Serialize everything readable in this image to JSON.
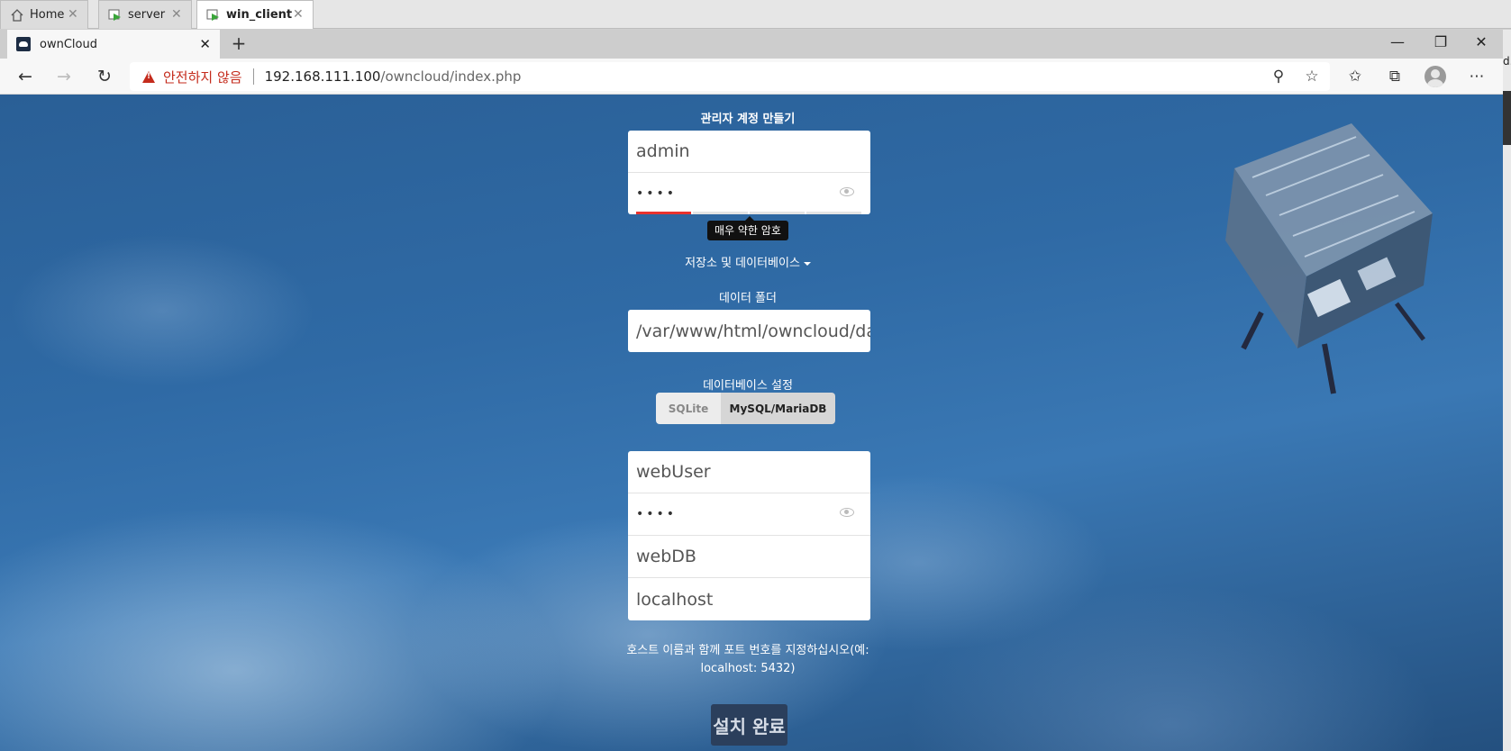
{
  "vm_tabs": [
    {
      "label": "Home",
      "icon": "home-icon",
      "active": false
    },
    {
      "label": "server",
      "icon": "vm-icon",
      "active": false
    },
    {
      "label": "win_client",
      "icon": "vm-icon",
      "active": true
    }
  ],
  "browser": {
    "tab_title": "ownCloud",
    "security_warning": "안전하지 않음",
    "url_host": "192.168.111.100",
    "url_path": "/owncloud/index.php"
  },
  "side_edge_text": "d.",
  "form": {
    "admin_heading": "관리자 계정 만들기",
    "admin_username": "admin",
    "admin_password": "••••",
    "password_strength_tooltip": "매우 약한 암호",
    "password_strength_level": "1/4",
    "storage_toggle": "저장소 및 데이터베이스",
    "data_folder_label": "데이터 폴더",
    "data_folder_value": "/var/www/html/owncloud/da",
    "db_settings_label": "데이터베이스 설정",
    "db_options": [
      "SQLite",
      "MySQL/MariaDB"
    ],
    "db_selected": "MySQL/MariaDB",
    "db_user": "webUser",
    "db_password": "••••",
    "db_name": "webDB",
    "db_host": "localhost",
    "host_hint_line1": "호스트 이름과 함께 포트 번호를 지정하십시오(예:",
    "host_hint_line2": "localhost: 5432)",
    "submit_label": "설치 완료"
  },
  "colors": {
    "accent_dark": "#1d2d44",
    "strength_weak": "#e9322d",
    "warning_red": "#c42b1c"
  }
}
